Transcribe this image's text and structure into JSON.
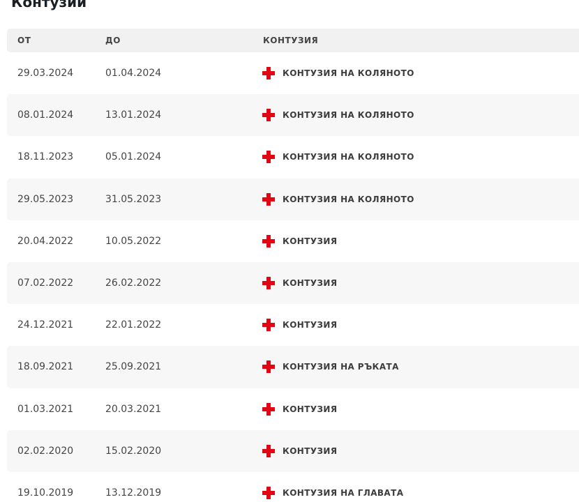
{
  "section": {
    "title": "Контузии"
  },
  "table": {
    "headers": {
      "from": "ОТ",
      "to": "ДО",
      "injury": "КОНТУЗИЯ"
    },
    "icon": {
      "name": "red-cross-icon",
      "color": "#e10613"
    },
    "rows": [
      {
        "from": "29.03.2024",
        "to": "01.04.2024",
        "injury": "КОНТУЗИЯ НА КОЛЯНОТО"
      },
      {
        "from": "08.01.2024",
        "to": "13.01.2024",
        "injury": "КОНТУЗИЯ НА КОЛЯНОТО"
      },
      {
        "from": "18.11.2023",
        "to": "05.01.2024",
        "injury": "КОНТУЗИЯ НА КОЛЯНОТО"
      },
      {
        "from": "29.05.2023",
        "to": "31.05.2023",
        "injury": "КОНТУЗИЯ НА КОЛЯНОТО"
      },
      {
        "from": "20.04.2022",
        "to": "10.05.2022",
        "injury": "КОНТУЗИЯ"
      },
      {
        "from": "07.02.2022",
        "to": "26.02.2022",
        "injury": "КОНТУЗИЯ"
      },
      {
        "from": "24.12.2021",
        "to": "22.01.2022",
        "injury": "КОНТУЗИЯ"
      },
      {
        "from": "18.09.2021",
        "to": "25.09.2021",
        "injury": "КОНТУЗИЯ НА РЪКАТА"
      },
      {
        "from": "01.03.2021",
        "to": "20.03.2021",
        "injury": "КОНТУЗИЯ"
      },
      {
        "from": "02.02.2020",
        "to": "15.02.2020",
        "injury": "КОНТУЗИЯ"
      },
      {
        "from": "19.10.2019",
        "to": "13.12.2019",
        "injury": "КОНТУЗИЯ НА ГЛАВАТА"
      }
    ]
  }
}
